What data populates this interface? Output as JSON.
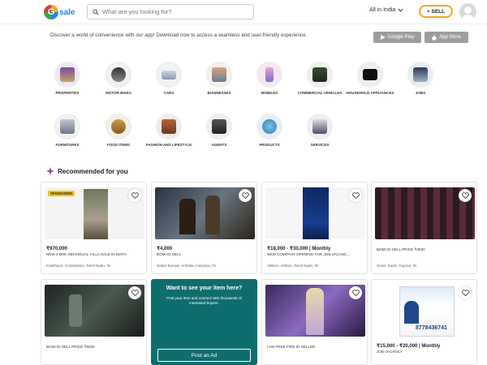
{
  "header": {
    "logo_text": "sale",
    "search_placeholder": "What are you looking for?",
    "location": "All in India",
    "sell_label": "+ SELL"
  },
  "banner": {
    "text": "Discover a world of convenience with our app! Download now to access a seamless and user-friendly experience.",
    "google_play": "Google Play",
    "app_store": "App Store"
  },
  "categories": [
    {
      "label": "PROPERTIES"
    },
    {
      "label": "MOTOR BIKES"
    },
    {
      "label": "CARS"
    },
    {
      "label": "BUSINESSES"
    },
    {
      "label": "MOBILES"
    },
    {
      "label": "COMMERCIAL VEHICLES"
    },
    {
      "label": "HOUSEHOLD APPLIANCES"
    },
    {
      "label": "JOBS"
    },
    {
      "label": "FURNITURES"
    },
    {
      "label": "FOOD ITEMS"
    },
    {
      "label": "FASHION AND LIFESTYLE"
    },
    {
      "label": "AGENTS"
    },
    {
      "label": "PRODUCTS"
    },
    {
      "label": "SERVICES"
    }
  ],
  "recommended_title": "Recommended for you",
  "listings": [
    {
      "badge": "SPONSORED",
      "price": "₹970,000",
      "title": "NEW 3 BHK INDIVIDUAL VILLA SALE IN MATH",
      "location": "Kalathiyur, Coimbatore, Tamil Nadu, IN"
    },
    {
      "price": "₹4,000",
      "title": "BGMI ID SELL",
      "location": "Sadar Bazaar, Ambala, Haryana, IN"
    },
    {
      "price": "₹18,000 - ₹30,000 | Monthly",
      "title": "NEW COMPANY OPENING FOR JOB VACANC...",
      "location": "Vellore, Vellore, Tamil Nadu, IN"
    },
    {
      "price": "",
      "title": "BGMI ID SELL PRICE ₹3500",
      "location": "Surat, Surat, Gujarat, IN"
    },
    {
      "price": "",
      "title": "BGMI ID SELL PRICE ₹6000",
      "location": ""
    },
    {
      "price": "",
      "title": "I AM FREE FIRE ID SELLER",
      "location": ""
    },
    {
      "price": "₹15,000 - ₹20,000 | Monthly",
      "title": "JOB VACANCY",
      "location": ""
    }
  ],
  "job_poster_phone": "8778436741",
  "promo": {
    "heading": "Want to see your item here?",
    "text": "Post your item and connect with thousands of interested buyers.",
    "button": "Post an Ad"
  },
  "colors": {
    "accent": "#f5a623",
    "promo_bg": "#0e6e6e",
    "sponsored": "#f5c518"
  }
}
